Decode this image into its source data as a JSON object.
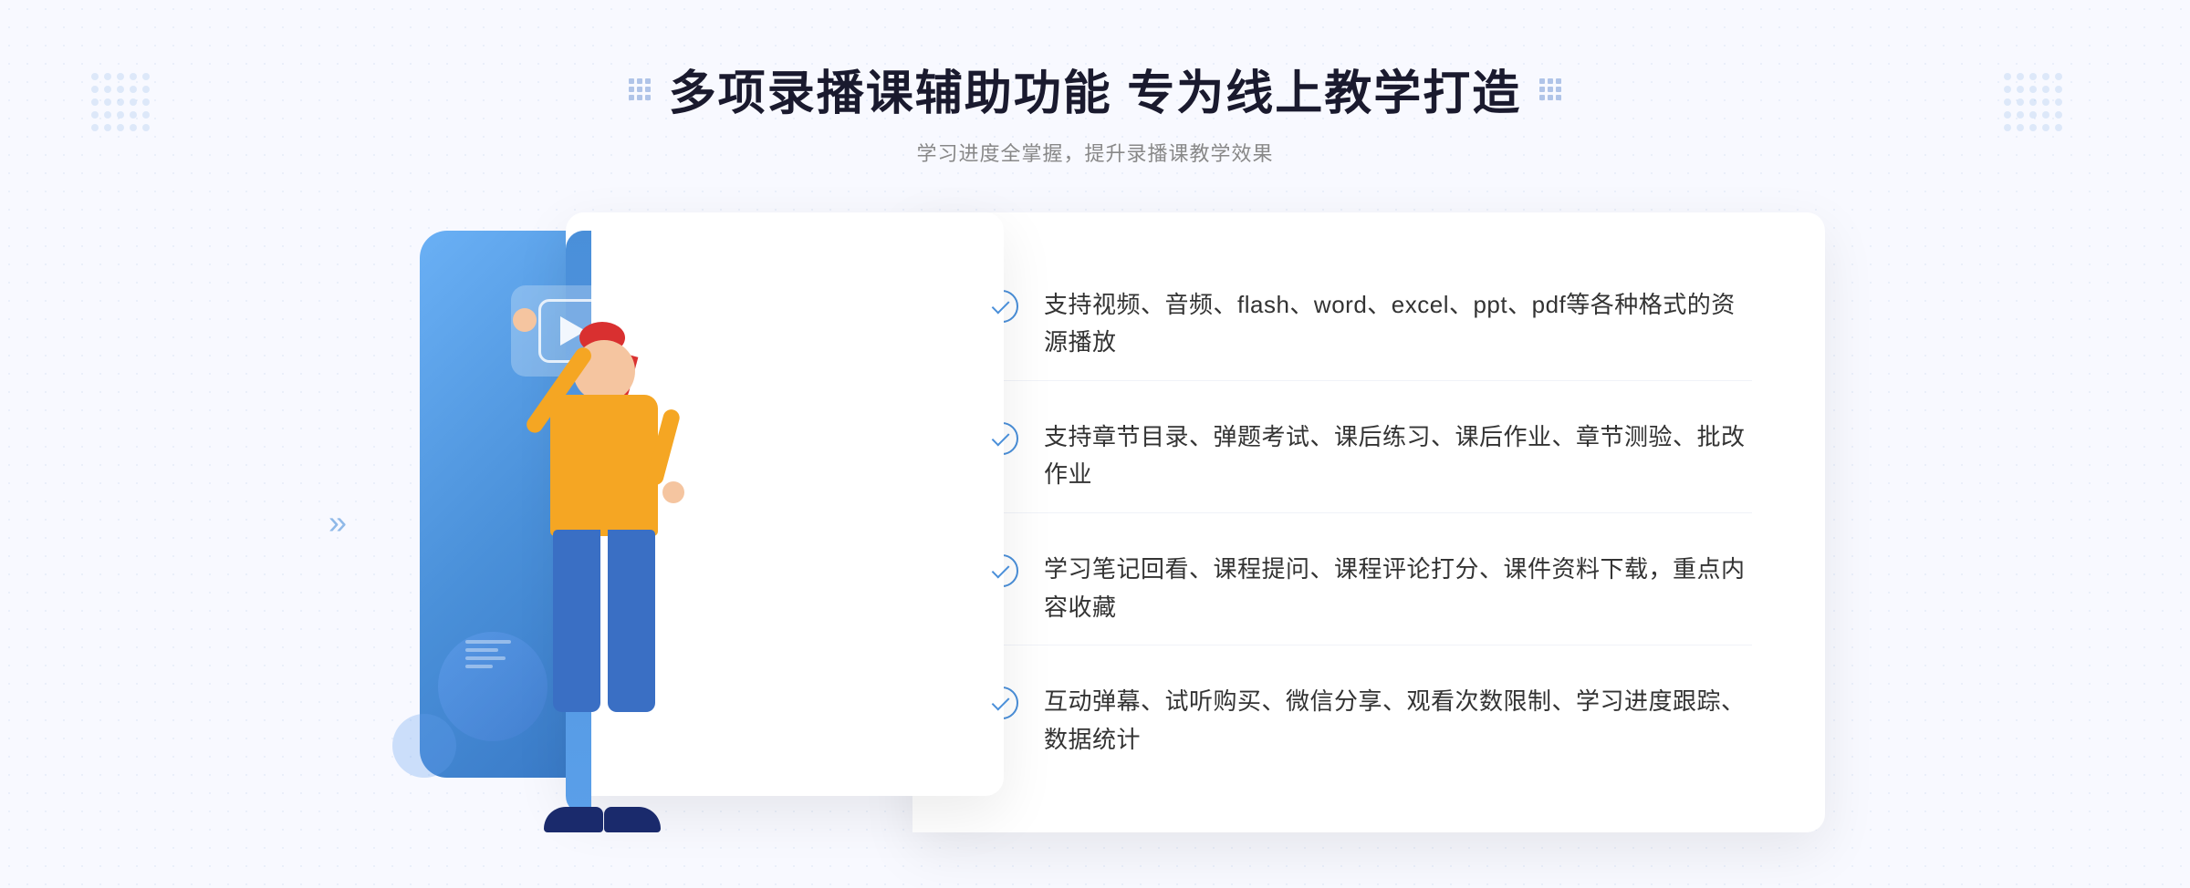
{
  "header": {
    "title": "多项录播课辅助功能 专为线上教学打造",
    "subtitle": "学习进度全掌握，提升录播课教学效果"
  },
  "features": [
    {
      "id": 1,
      "text": "支持视频、音频、flash、word、excel、ppt、pdf等各种格式的资源播放"
    },
    {
      "id": 2,
      "text": "支持章节目录、弹题考试、课后练习、课后作业、章节测验、批改作业"
    },
    {
      "id": 3,
      "text": "学习笔记回看、课程提问、课程评论打分、课件资料下载，重点内容收藏"
    },
    {
      "id": 4,
      "text": "互动弹幕、试听购买、微信分享、观看次数限制、学习进度跟踪、数据统计"
    }
  ],
  "colors": {
    "primary": "#4a8fd9",
    "text_dark": "#1a1a2e",
    "text_mid": "#333333",
    "text_light": "#888888",
    "bg": "#f8f9ff",
    "white": "#ffffff"
  },
  "decorative": {
    "arrow_symbol": "»",
    "play_label": "play-button"
  }
}
